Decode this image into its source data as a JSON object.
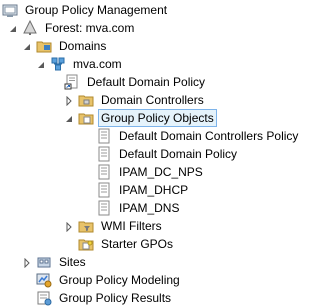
{
  "tree": {
    "root": {
      "label": "Group Policy Management",
      "icon": "gpm-console-icon"
    },
    "forest": {
      "label": "Forest: mva.com",
      "icon": "forest-icon",
      "expanded": true
    },
    "domains": {
      "label": "Domains",
      "icon": "domains-folder-icon",
      "expanded": true
    },
    "domain": {
      "label": "mva.com",
      "icon": "domain-icon",
      "expanded": true
    },
    "default_domain_policy_link": {
      "label": "Default Domain Policy",
      "icon": "gpo-link-icon"
    },
    "domain_controllers": {
      "label": "Domain Controllers",
      "icon": "ou-folder-icon",
      "expanded": false
    },
    "group_policy_objects": {
      "label": "Group Policy Objects",
      "icon": "gpo-folder-icon",
      "expanded": true,
      "selected": true
    },
    "gpos": [
      {
        "label": "Default Domain Controllers Policy",
        "icon": "gpo-icon"
      },
      {
        "label": "Default Domain Policy",
        "icon": "gpo-icon"
      },
      {
        "label": "IPAM_DC_NPS",
        "icon": "gpo-icon"
      },
      {
        "label": "IPAM_DHCP",
        "icon": "gpo-icon"
      },
      {
        "label": "IPAM_DNS",
        "icon": "gpo-icon"
      }
    ],
    "wmi_filters": {
      "label": "WMI Filters",
      "icon": "wmi-folder-icon",
      "expanded": false
    },
    "starter_gpos": {
      "label": "Starter GPOs",
      "icon": "starter-gpo-folder-icon"
    },
    "sites": {
      "label": "Sites",
      "icon": "sites-icon",
      "expanded": false
    },
    "modeling": {
      "label": "Group Policy Modeling",
      "icon": "modeling-icon"
    },
    "results": {
      "label": "Group Policy Results",
      "icon": "results-icon"
    }
  },
  "colors": {
    "selection_fill": "#e5f3fb",
    "selection_border": "#7eb4ea",
    "folder": "#e8c36a",
    "arrow": "#5a5a5a"
  }
}
